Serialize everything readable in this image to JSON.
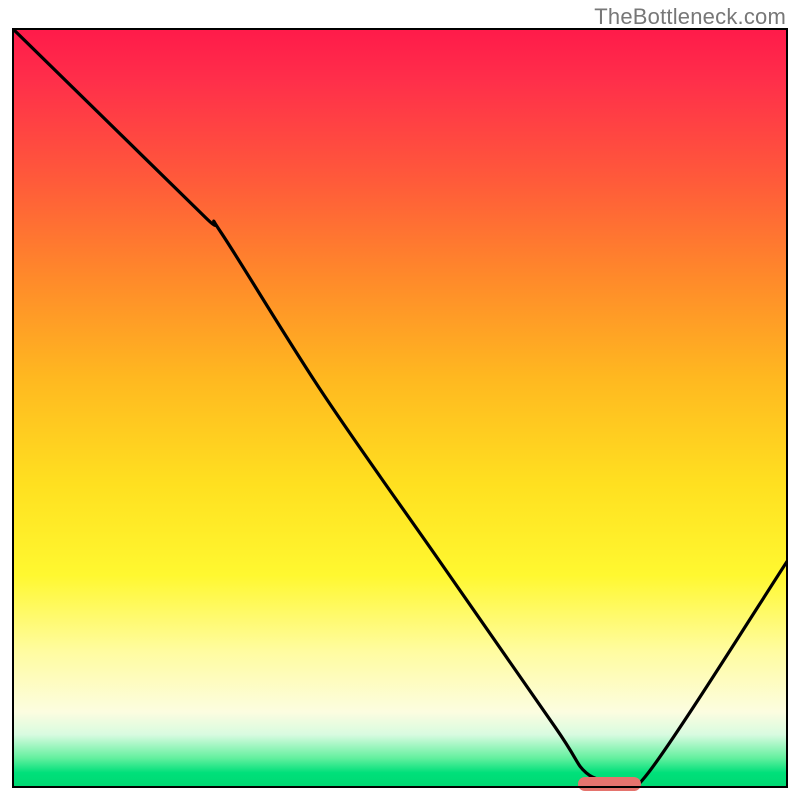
{
  "watermark": "TheBottleneck.com",
  "chart_data": {
    "type": "line",
    "title": "",
    "xlabel": "",
    "ylabel": "",
    "xlim": [
      0,
      100
    ],
    "ylim": [
      0,
      100
    ],
    "grid": false,
    "background_gradient": {
      "direction": "vertical",
      "stops": [
        {
          "pos": 0,
          "color": "#ff1a4a"
        },
        {
          "pos": 20,
          "color": "#ff5a3a"
        },
        {
          "pos": 46,
          "color": "#ffb820"
        },
        {
          "pos": 72,
          "color": "#fff830"
        },
        {
          "pos": 90,
          "color": "#fcfde0"
        },
        {
          "pos": 100,
          "color": "#00d872"
        }
      ]
    },
    "series": [
      {
        "name": "bottleneck-curve",
        "color": "#000000",
        "x": [
          0,
          10,
          25,
          27,
          40,
          55,
          70,
          74,
          78,
          82,
          100
        ],
        "values": [
          100,
          90,
          75,
          73,
          52,
          30,
          8,
          2,
          1,
          2,
          30
        ]
      }
    ],
    "annotations": [
      {
        "name": "optimal-marker",
        "shape": "rounded-bar",
        "color": "#e5746e",
        "x": 77,
        "y": 0.5,
        "width_pct": 8,
        "height_pct": 1.8
      }
    ]
  }
}
